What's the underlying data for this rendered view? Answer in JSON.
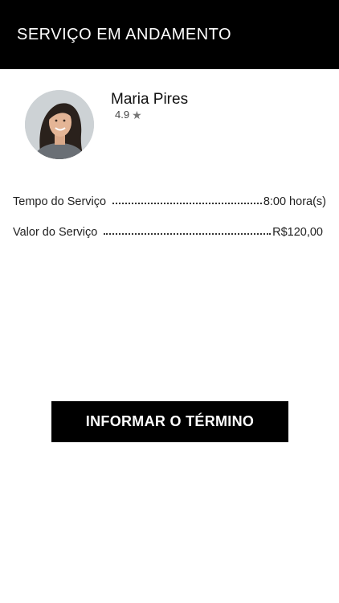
{
  "header": {
    "title": "SERVIÇO EM ANDAMENTO"
  },
  "profile": {
    "name": "Maria Pires",
    "rating": "4.9",
    "rating_icon": "star-icon",
    "avatar_icon": "avatar-photo"
  },
  "service": {
    "time_label": "Tempo do Serviço",
    "time_value": "8:00 hora(s)",
    "price_label": "Valor do Serviço",
    "price_value": "R$120,00"
  },
  "actions": {
    "finish_label": "INFORMAR O TÉRMINO"
  },
  "colors": {
    "header_bg": "#000000",
    "button_bg": "#000000",
    "text": "#111111"
  }
}
